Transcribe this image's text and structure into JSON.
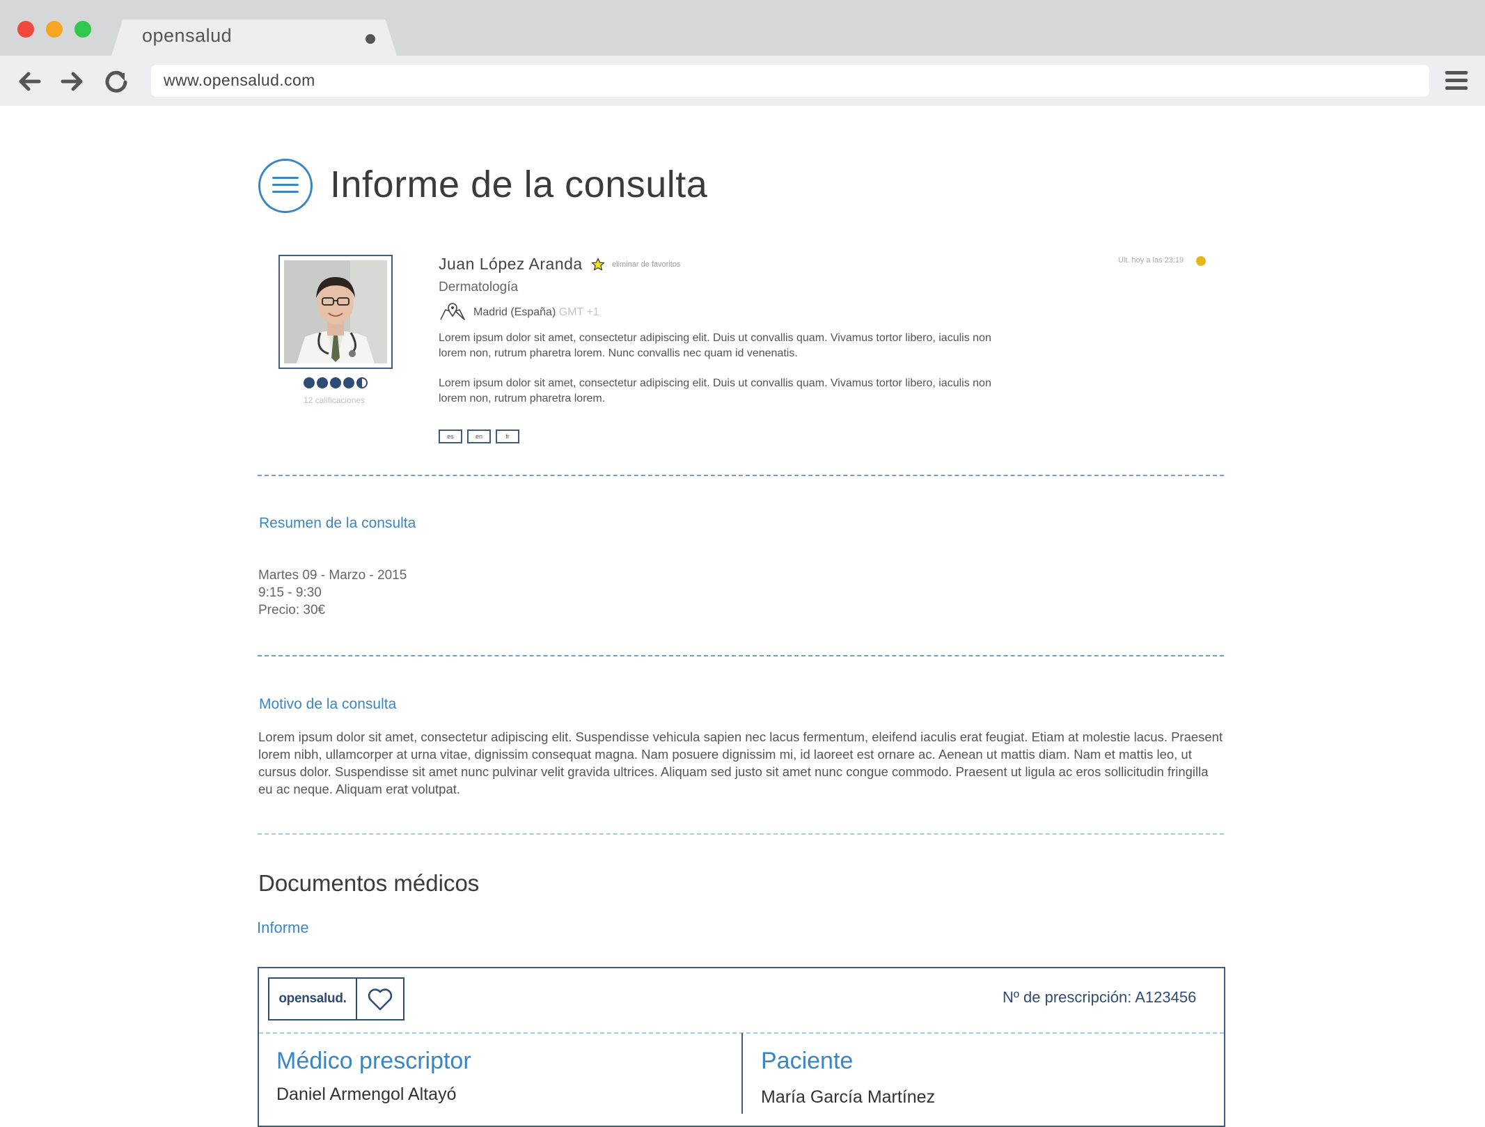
{
  "browser": {
    "tab_title": "opensalud",
    "url": "www.opensalud.com"
  },
  "page": {
    "title": "Informe de la consulta"
  },
  "doctor": {
    "name": "Juan López Aranda",
    "favorite_action": "eliminar de favoritos",
    "last_seen": "Ult. hoy a las 23:19",
    "specialty": "Dermatología",
    "location": "Madrid (España)",
    "timezone": "GMT +1",
    "bio_1": "Lorem ipsum dolor sit amet, consectetur adipiscing elit. Duis ut convallis quam. Vivamus tortor libero, iaculis non lorem non, rutrum pharetra lorem. Nunc convallis nec quam id venenatis.",
    "bio_2": "Lorem ipsum dolor sit amet, consectetur adipiscing elit. Duis ut convallis quam. Vivamus tortor libero, iaculis non lorem non, rutrum pharetra lorem.",
    "rating": 4.5,
    "rating_max": 5,
    "ratings_count": "12 calificaciones",
    "languages": [
      "es",
      "en",
      "fr"
    ]
  },
  "summary": {
    "label": "Resumen de la consulta",
    "date": "Martes 09 - Marzo - 2015",
    "time": "9:15 - 9:30",
    "price": "Precio: 30€"
  },
  "motivo": {
    "label": "Motivo de la consulta",
    "text": "Lorem ipsum dolor sit amet, consectetur adipiscing elit. Suspendisse vehicula sapien nec lacus fermentum, eleifend iaculis erat feugiat. Etiam at molestie lacus. Praesent lorem nibh, ullamcorper at urna vitae, dignissim consequat magna. Nam posuere dignissim mi, id laoreet est ornare ac. Aenean ut mattis diam. Nam et mattis leo, ut cursus dolor. Suspendisse sit amet nunc pulvinar velit gravida ultrices. Aliquam sed justo sit amet nunc congue commodo. Praesent ut ligula ac eros sollicitudin fringilla eu ac neque. Aliquam erat volutpat."
  },
  "documents": {
    "title": "Documentos médicos",
    "link": "Informe"
  },
  "prescription": {
    "logo": "opensalud.",
    "number": "Nº de prescripción: A123456",
    "prescriber_label": "Médico prescriptor",
    "prescriber_name": "Daniel Armengol Altayó",
    "patient_label": "Paciente",
    "patient_name": "María García Martínez"
  },
  "colors": {
    "accent": "#3a86c2",
    "navy": "#2f4c74",
    "status": "#e4b81a"
  }
}
